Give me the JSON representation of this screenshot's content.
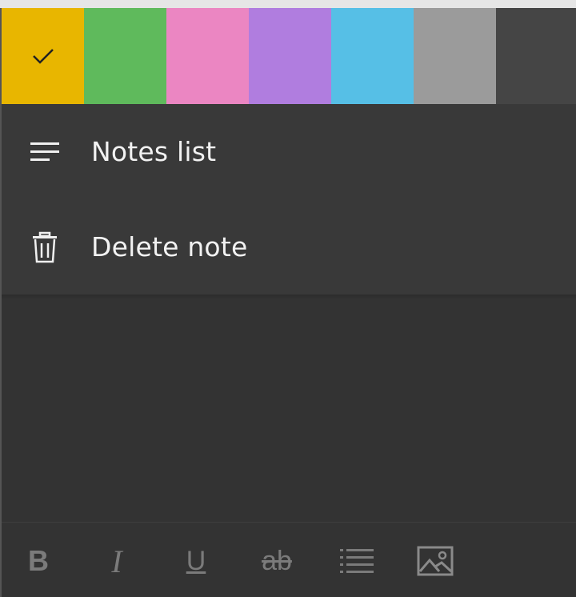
{
  "colors": {
    "swatches": [
      {
        "name": "yellow",
        "hex": "#e8b600",
        "selected": true
      },
      {
        "name": "green",
        "hex": "#5fba5c"
      },
      {
        "name": "pink",
        "hex": "#eb86c2"
      },
      {
        "name": "purple",
        "hex": "#b07ddf"
      },
      {
        "name": "blue",
        "hex": "#56bfe6"
      },
      {
        "name": "gray",
        "hex": "#9b9b9b"
      },
      {
        "name": "charcoal",
        "hex": "#454545"
      }
    ],
    "selected_icon": "checkmark-icon"
  },
  "menu": {
    "items": [
      {
        "label": "Notes list",
        "icon": "list-icon"
      },
      {
        "label": "Delete note",
        "icon": "trash-icon"
      }
    ]
  },
  "toolbar": {
    "bold_label": "B",
    "italic_label": "I",
    "underline_label": "U",
    "strikethrough_label": "ab",
    "icons": [
      "bold-icon",
      "italic-icon",
      "underline-icon",
      "strikethrough-icon",
      "bullet-list-icon",
      "image-icon"
    ]
  }
}
